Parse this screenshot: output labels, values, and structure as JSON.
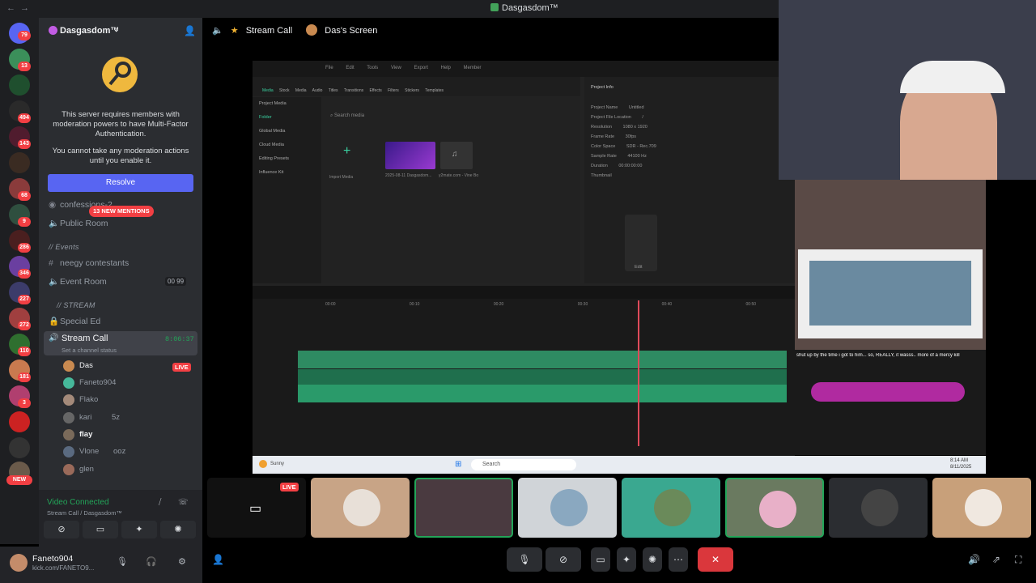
{
  "window": {
    "title": "Dasgasdom™"
  },
  "guild_badges": [
    "79",
    "13",
    "494",
    "143",
    "68",
    "9",
    "286",
    "346",
    "227",
    "272",
    "110",
    "181",
    "3"
  ],
  "guild_new": "NEW",
  "server": {
    "name": "Dasgasdom™"
  },
  "mfa": {
    "line1": "This server requires members with moderation powers to have Multi-Factor Authentication.",
    "line2": "You cannot take any moderation actions until you enable it.",
    "button": "Resolve"
  },
  "channels": {
    "confessions": "confessions-2",
    "mentions": "13 NEW MENTIONS",
    "public_room": "Public Room",
    "events_cat": "// Events",
    "neegy": "neegy contestants",
    "event_room": "Event Room",
    "event_room_count": "00 99",
    "stream_cat": "// STREAM",
    "special_ed": "Special Ed",
    "stream_call": "Stream Call",
    "stream_time": "8:06:37",
    "status": "Set a channel status"
  },
  "voice_users": [
    {
      "name": "Das",
      "color": "#c98a50"
    },
    {
      "name": "Faneto904",
      "color": "#46b89a"
    },
    {
      "name": "Flako",
      "color": "#a48a7a"
    },
    {
      "name": "kari",
      "color": "#666"
    },
    {
      "name": "flay",
      "color": "#7a6a5a"
    },
    {
      "name": "Vlone",
      "color": "#5a6a80"
    },
    {
      "name": "glen",
      "color": "#9a6a5a"
    }
  ],
  "kari_extra": "5z",
  "vlone_extra": "ooz",
  "live": "LIVE",
  "voice_connected": {
    "status": "Video Connected",
    "location": "Stream Call / Dasgasdom™"
  },
  "user": {
    "name": "Faneto904",
    "status": "kick.com/FANETO9..."
  },
  "call_header": {
    "channel": "Stream Call",
    "screen": "Das's Screen"
  },
  "editor": {
    "menu": [
      "File",
      "Edit",
      "Tools",
      "View",
      "Export",
      "Help",
      "Member"
    ],
    "tabs": [
      "Media",
      "Stock Media",
      "Audio",
      "Titles",
      "Transitions",
      "Effects",
      "Filters",
      "Stickers",
      "Templates"
    ],
    "side": [
      "Project Media",
      "Folder",
      "Global Media",
      "Cloud Media",
      "Editing Presets",
      "Influence Kit"
    ],
    "search": "Search media",
    "import": "Import Media",
    "clip1": "2025-08-11 Dasgasdom...",
    "clip2": "y2mate.com - Vine Bo",
    "proj_title": "Project Info",
    "proj": [
      [
        "Project Name",
        "Untitled"
      ],
      [
        "Project File Location",
        "/"
      ],
      [
        "Resolution",
        "1080 x 1920"
      ],
      [
        "Frame Rate",
        "30fps"
      ],
      [
        "Color Space",
        "SDR - Rec.709"
      ],
      [
        "Sample Rate",
        "44100 Hz"
      ],
      [
        "Duration",
        "00:00:00:00"
      ],
      [
        "Thumbnail",
        ""
      ]
    ],
    "edit": "Edit",
    "times": [
      "00:00",
      "00:10",
      "00:20",
      "00:30",
      "00:40",
      "00:50"
    ]
  },
  "taskbar": {
    "search": "Search",
    "weather": "Sunny",
    "time": "8:14 AM",
    "date": "8/11/2025"
  },
  "caption": "shut up by the time i got to him... so, REALLY, it wasss.. more of a mercy kill",
  "tile_live": "LIVE"
}
